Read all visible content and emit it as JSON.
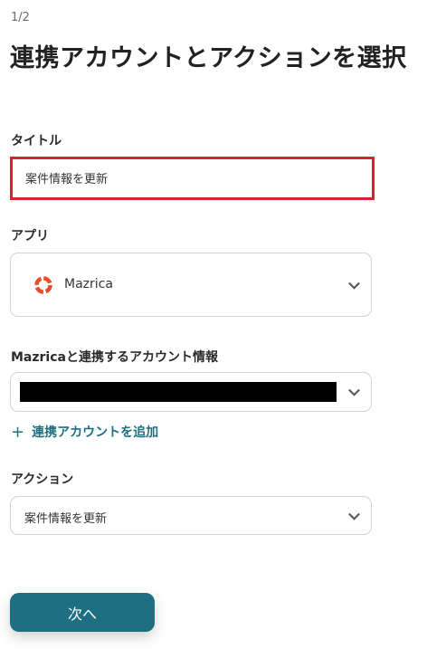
{
  "header": {
    "step": "1/2",
    "title": "連携アカウントとアクションを選択"
  },
  "title_field": {
    "label": "タイトル",
    "value": "案件情報を更新"
  },
  "app_field": {
    "label": "アプリ",
    "selected": "Mazrica",
    "icon": "mazrica-logo-icon"
  },
  "account_field": {
    "label": "Mazricaと連携するアカウント情報",
    "add_link": "連携アカウントを追加"
  },
  "action_field": {
    "label": "アクション",
    "selected": "案件情報を更新"
  },
  "footer": {
    "next_label": "次へ"
  },
  "colors": {
    "accent": "#1f6f82",
    "highlight_border": "#e0202f",
    "logo": "#ea4b2a"
  }
}
